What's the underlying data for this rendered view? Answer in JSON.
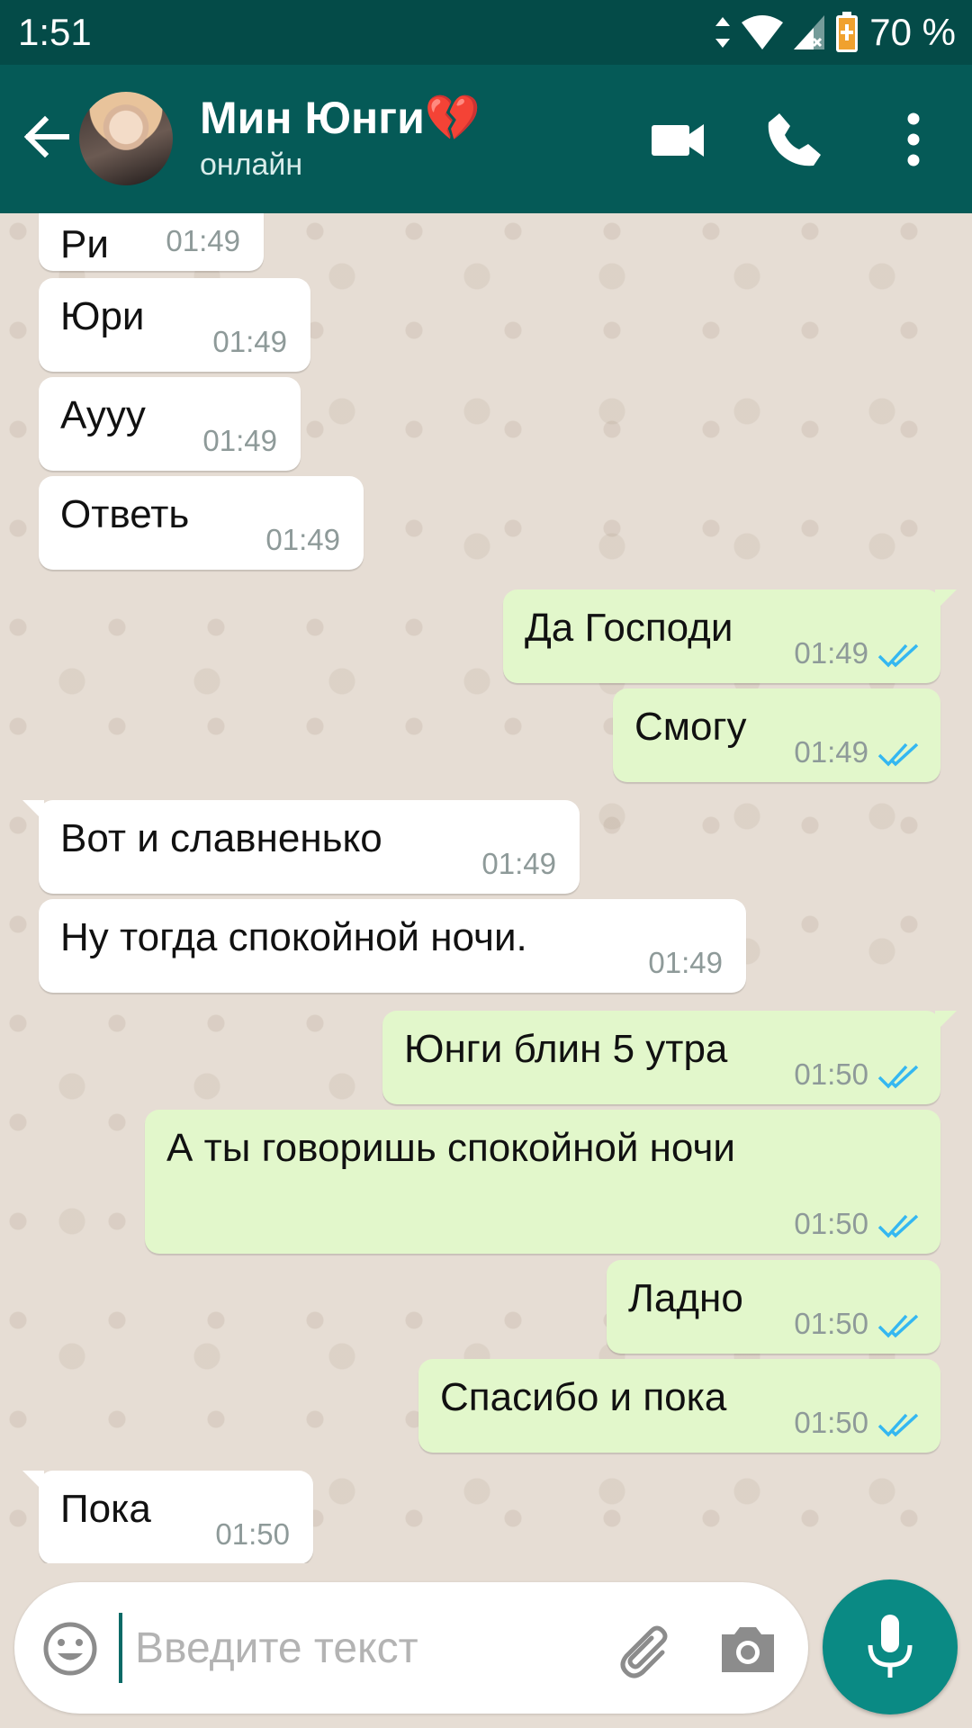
{
  "status_bar": {
    "time": "1:51",
    "battery_text": "70 %"
  },
  "header": {
    "contact_name": "Мин Юнги💔",
    "status": "онлайн",
    "icons": [
      "back-arrow-icon",
      "video-call-icon",
      "phone-icon",
      "more-vert-icon"
    ]
  },
  "messages": [
    {
      "dir": "in",
      "text": "Ри",
      "time": "01:49"
    },
    {
      "dir": "in",
      "text": "Юри",
      "time": "01:49"
    },
    {
      "dir": "in",
      "text": "Аууу",
      "time": "01:49"
    },
    {
      "dir": "in",
      "text": "Ответь",
      "time": "01:49"
    },
    {
      "dir": "out",
      "text": "Да Господи",
      "time": "01:49",
      "status": "read"
    },
    {
      "dir": "out",
      "text": "Смогу",
      "time": "01:49",
      "status": "read"
    },
    {
      "dir": "in",
      "text": "Вот и славненько",
      "time": "01:49"
    },
    {
      "dir": "in",
      "text": "Ну тогда спокойной ночи.",
      "time": "01:49"
    },
    {
      "dir": "out",
      "text": "Юнги блин 5 утра",
      "time": "01:50",
      "status": "read"
    },
    {
      "dir": "out",
      "text": "А ты говоришь спокойной ночи",
      "time": "01:50",
      "status": "read"
    },
    {
      "dir": "out",
      "text": "Ладно",
      "time": "01:50",
      "status": "read"
    },
    {
      "dir": "out",
      "text": "Спасибо и пока",
      "time": "01:50",
      "status": "read"
    },
    {
      "dir": "in",
      "text": "Пока",
      "time": "01:50"
    }
  ],
  "composer": {
    "placeholder": "Введите текст",
    "icons": [
      "emoji-icon",
      "attach-icon",
      "camera-icon",
      "mic-icon"
    ]
  },
  "colors": {
    "header": "#055a57",
    "status_bar": "#044b48",
    "chat_bg": "#e6ddd4",
    "incoming_bubble": "#ffffff",
    "outgoing_bubble": "#e2f7cb",
    "read_ticks": "#34b7f1",
    "send_button": "#0a8a84"
  }
}
